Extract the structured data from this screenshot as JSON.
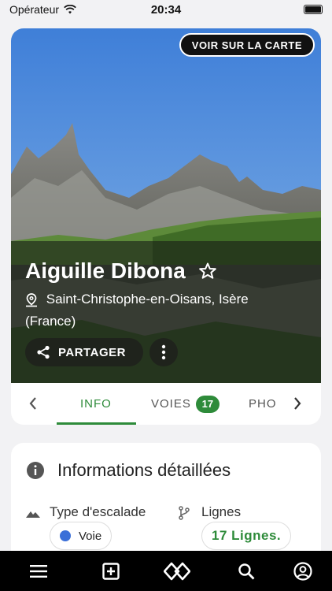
{
  "status_bar": {
    "carrier": "Opérateur",
    "time": "20:34"
  },
  "hero": {
    "map_button": "VOIR SUR LA CARTE",
    "title": "Aiguille Dibona",
    "location": "Saint-Christophe-en-Oisans, Isère (France)",
    "share_button": "PARTAGER"
  },
  "tabs": {
    "info": "INFO",
    "voies": "VOIES",
    "voies_count": "17",
    "photos": "PHO"
  },
  "details": {
    "heading": "Informations détaillées",
    "climbing_type_label": "Type d'escalade",
    "climbing_type_value": "Voie",
    "lines_label": "Lignes",
    "lines_value": "17 Lignes."
  },
  "colors": {
    "accent": "#2e8b3a",
    "voie_dot": "#3a6fd8"
  },
  "icons": [
    "wifi-icon",
    "battery-icon",
    "star-outline-icon",
    "location-pin-icon",
    "share-icon",
    "more-vert-icon",
    "chevron-left-icon",
    "chevron-right-icon",
    "info-icon",
    "terrain-icon",
    "branch-icon",
    "menu-icon",
    "add-box-icon",
    "diamond-route-icon",
    "search-icon",
    "account-circle-icon"
  ]
}
